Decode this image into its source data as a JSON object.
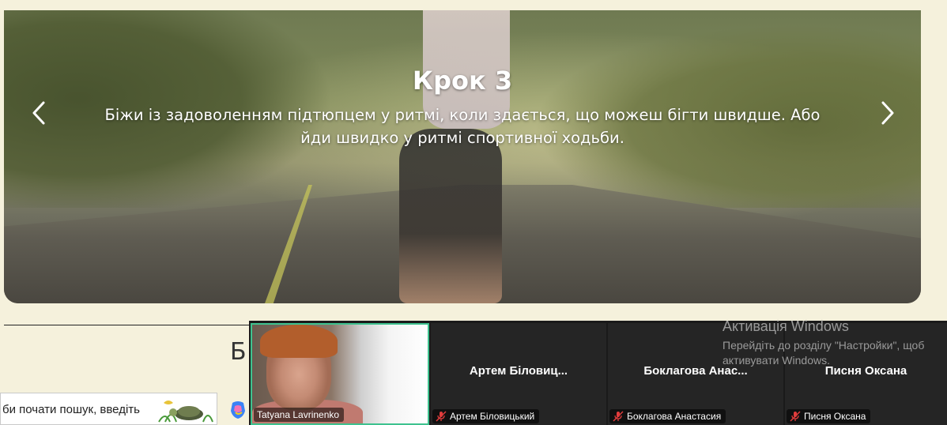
{
  "carousel": {
    "title": "Крок 3",
    "text": "Біжи із задоволенням підтюпцем у ритмі, коли здається, що можеш бігти швидше. Або йди швидко у ритмі спортивної ходьби."
  },
  "page": {
    "partial_heading": "Б"
  },
  "taskbar": {
    "search_placeholder": "би почати пошук, введіть"
  },
  "zoom": {
    "participants": [
      {
        "tag": "Tatyana Lavrinenko",
        "muted": false
      },
      {
        "name": "Артем Біловиц...",
        "tag": "Артем Біловицький",
        "muted": true
      },
      {
        "name": "Боклагова  Анас...",
        "tag": "Боклагова Анастасия",
        "muted": true
      },
      {
        "name": "Писня Оксана",
        "tag": "Писня Оксана",
        "muted": true
      }
    ],
    "mute_color": "#e03c3c",
    "active_border_color": "#3ec28f"
  },
  "activation": {
    "title": "Активація Windows",
    "line1": "Перейдіть до розділу \"Настройки\", щоб",
    "line2": "активувати Windows."
  }
}
